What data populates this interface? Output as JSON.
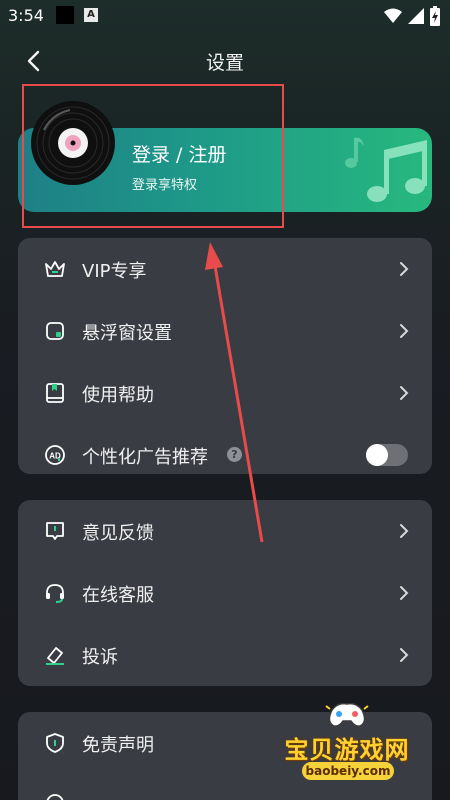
{
  "status_bar": {
    "time": "3:54",
    "app_letter": "A"
  },
  "header": {
    "title": "设置"
  },
  "login": {
    "title": "登录 / 注册",
    "subtitle": "登录享特权"
  },
  "group1": [
    {
      "label": "VIP专享",
      "icon": "vip-crown-icon"
    },
    {
      "label": "悬浮窗设置",
      "icon": "floating-window-icon"
    },
    {
      "label": "使用帮助",
      "icon": "help-book-icon"
    },
    {
      "label": "个性化广告推荐",
      "icon": "ad-icon",
      "help": "?",
      "toggle_on": false
    }
  ],
  "group2": [
    {
      "label": "意见反馈",
      "icon": "feedback-icon"
    },
    {
      "label": "在线客服",
      "icon": "headset-icon"
    },
    {
      "label": "投诉",
      "icon": "complaint-eraser-icon"
    }
  ],
  "group3": [
    {
      "label": "免责声明",
      "icon": "shield-icon"
    }
  ],
  "watermark": {
    "text": "宝贝游戏网",
    "url": "baobeiy.com"
  },
  "colors": {
    "accent_green": "#27b87e",
    "annotation_red": "#e84b4b",
    "card_bg": "#3a3c43"
  }
}
